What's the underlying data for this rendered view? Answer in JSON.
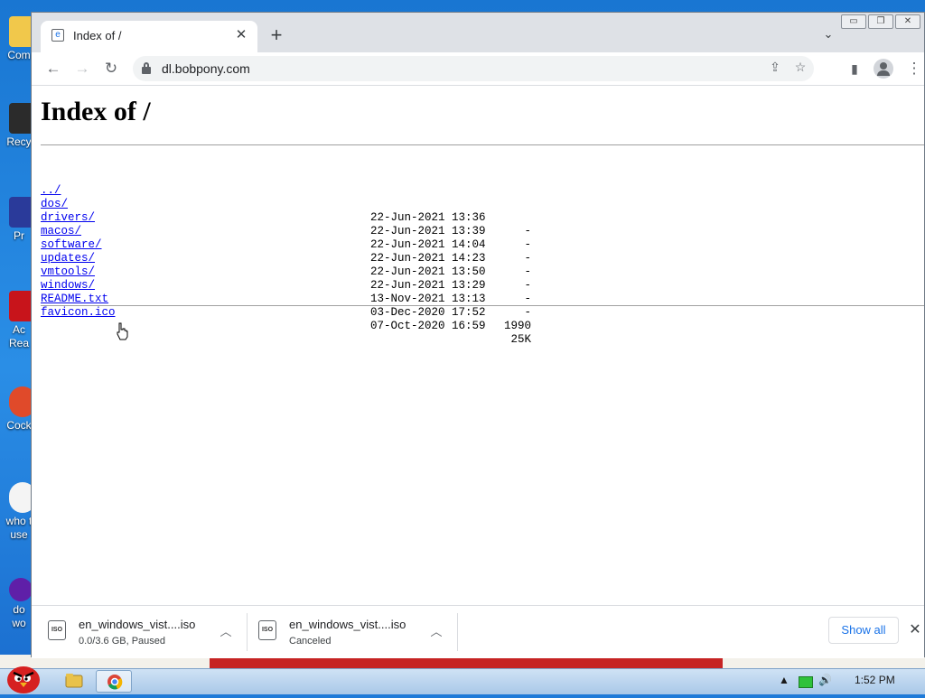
{
  "desktop": {
    "icons": [
      {
        "label": "Com"
      },
      {
        "label": "Recy"
      },
      {
        "label": "Pr"
      },
      {
        "label": "Ac"
      },
      {
        "label": "Rea"
      },
      {
        "label": "Cock"
      },
      {
        "label": "who t"
      },
      {
        "label": "use"
      },
      {
        "label": "do"
      },
      {
        "label": "wo"
      }
    ]
  },
  "browser": {
    "tab_title": "Index of /",
    "url": "dl.bobpony.com",
    "page": {
      "heading": "Index of /",
      "entries": [
        {
          "name": "../",
          "date": "",
          "size": ""
        },
        {
          "name": "dos/",
          "date": "22-Jun-2021 13:36",
          "size": "-"
        },
        {
          "name": "drivers/",
          "date": "22-Jun-2021 13:39",
          "size": "-"
        },
        {
          "name": "macos/",
          "date": "22-Jun-2021 14:04",
          "size": "-"
        },
        {
          "name": "software/",
          "date": "22-Jun-2021 14:23",
          "size": "-"
        },
        {
          "name": "updates/",
          "date": "22-Jun-2021 13:50",
          "size": "-"
        },
        {
          "name": "vmtools/",
          "date": "22-Jun-2021 13:29",
          "size": "-"
        },
        {
          "name": "windows/",
          "date": "13-Nov-2021 13:13",
          "size": "-"
        },
        {
          "name": "README.txt",
          "date": "03-Dec-2020 17:52",
          "size": "1990"
        },
        {
          "name": "favicon.ico",
          "date": "07-Oct-2020 16:59",
          "size": "25K"
        }
      ]
    },
    "downloads": [
      {
        "icon_text": "ISO",
        "name": "en_windows_vist....iso",
        "status": "0.0/3.6 GB, Paused"
      },
      {
        "icon_text": "ISO",
        "name": "en_windows_vist....iso",
        "status": "Canceled"
      }
    ],
    "show_all_label": "Show all"
  },
  "taskbar": {
    "clock": "1:52 PM"
  },
  "colors": {
    "link": "#0000ee",
    "desktop": "#1976d2",
    "tabstrip": "#dee1e6",
    "show_all": "#1a73e8"
  }
}
